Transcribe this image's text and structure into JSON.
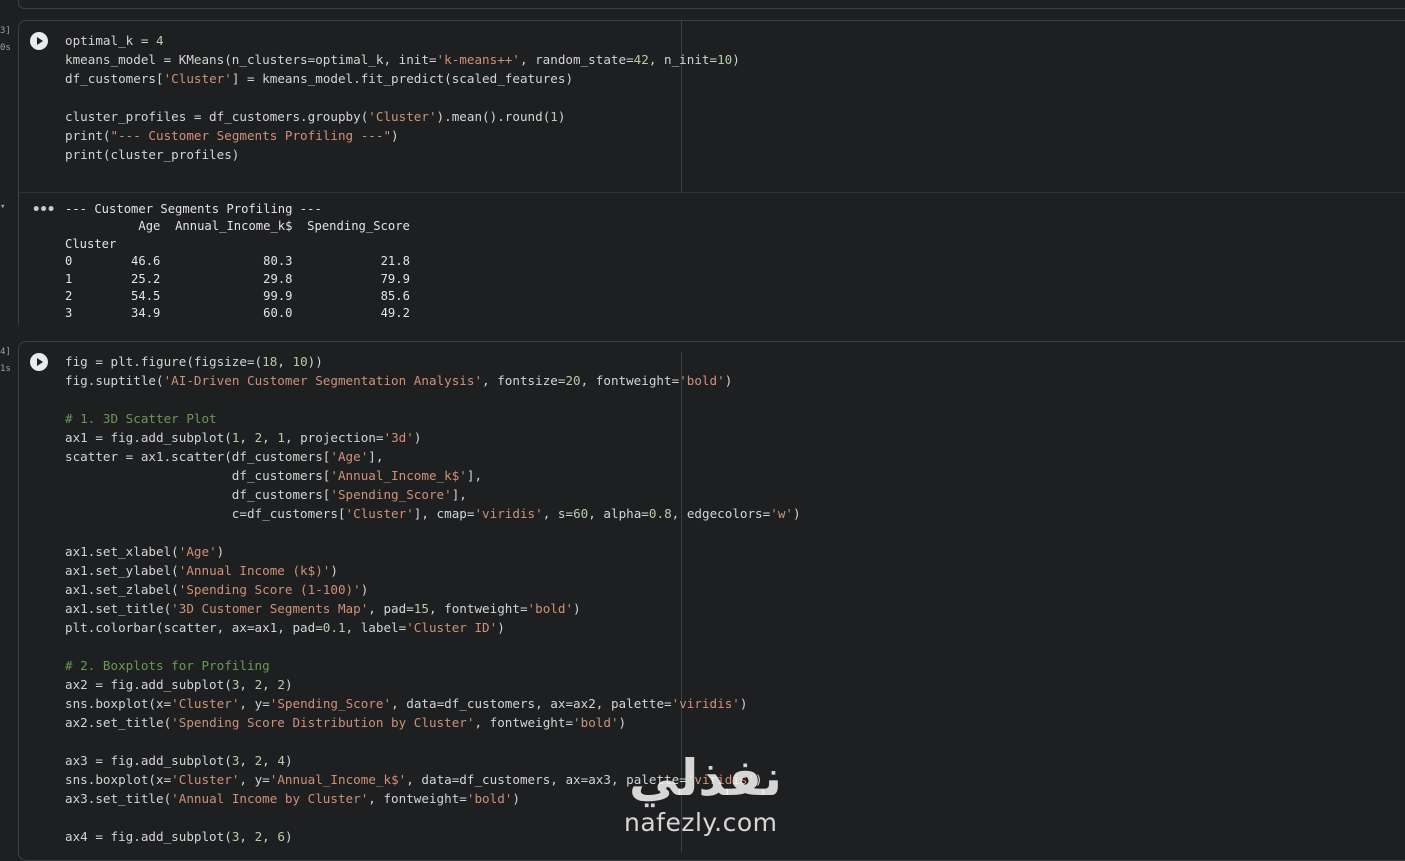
{
  "gutter": {
    "cell1_count": "3]",
    "cell1_time": "0s",
    "output_marker": "▾",
    "cell2_count": "4]",
    "cell2_time": "1s"
  },
  "cell1": {
    "lines": [
      "optimal_k = 4",
      "kmeans_model = KMeans(n_clusters=optimal_k, init='k-means++', random_state=42, n_init=10)",
      "df_customers['Cluster'] = kmeans_model.fit_predict(scaled_features)",
      "",
      "cluster_profiles = df_customers.groupby('Cluster').mean().round(1)",
      "print(\"--- Customer Segments Profiling ---\")",
      "print(cluster_profiles)"
    ]
  },
  "output1": {
    "header": "--- Customer Segments Profiling ---",
    "columns": [
      "Age",
      "Annual_Income_k$",
      "Spending_Score"
    ],
    "index_name": "Cluster",
    "rows": [
      {
        "cluster": "0",
        "age": "46.6",
        "income": "80.3",
        "score": "21.8"
      },
      {
        "cluster": "1",
        "age": "25.2",
        "income": "29.8",
        "score": "79.9"
      },
      {
        "cluster": "2",
        "age": "54.5",
        "income": "99.9",
        "score": "85.6"
      },
      {
        "cluster": "3",
        "age": "34.9",
        "income": "60.0",
        "score": "49.2"
      }
    ]
  },
  "cell2": {
    "lines": [
      "fig = plt.figure(figsize=(18, 10))",
      "fig.suptitle('AI-Driven Customer Segmentation Analysis', fontsize=20, fontweight='bold')",
      "",
      "# 1. 3D Scatter Plot",
      "ax1 = fig.add_subplot(1, 2, 1, projection='3d')",
      "scatter = ax1.scatter(df_customers['Age'],",
      "                      df_customers['Annual_Income_k$'],",
      "                      df_customers['Spending_Score'],",
      "                      c=df_customers['Cluster'], cmap='viridis', s=60, alpha=0.8, edgecolors='w')",
      "",
      "ax1.set_xlabel('Age')",
      "ax1.set_ylabel('Annual Income (k$)')",
      "ax1.set_zlabel('Spending Score (1-100)')",
      "ax1.set_title('3D Customer Segments Map', pad=15, fontweight='bold')",
      "plt.colorbar(scatter, ax=ax1, pad=0.1, label='Cluster ID')",
      "",
      "# 2. Boxplots for Profiling",
      "ax2 = fig.add_subplot(3, 2, 2)",
      "sns.boxplot(x='Cluster', y='Spending_Score', data=df_customers, ax=ax2, palette='viridis')",
      "ax2.set_title('Spending Score Distribution by Cluster', fontweight='bold')",
      "",
      "ax3 = fig.add_subplot(3, 2, 4)",
      "sns.boxplot(x='Cluster', y='Annual_Income_k$', data=df_customers, ax=ax3, palette='viridis')",
      "ax3.set_title('Annual Income by Cluster', fontweight='bold')",
      "",
      "ax4 = fig.add_subplot(3, 2, 6)"
    ]
  },
  "watermark": {
    "arabic": "نفذلي",
    "latin": "nafezly.com"
  },
  "colors": {
    "background": "#1e1f21",
    "string": "#ce9178",
    "number": "#b5cea8",
    "comment": "#6a9955",
    "text": "#d4d4d4"
  }
}
